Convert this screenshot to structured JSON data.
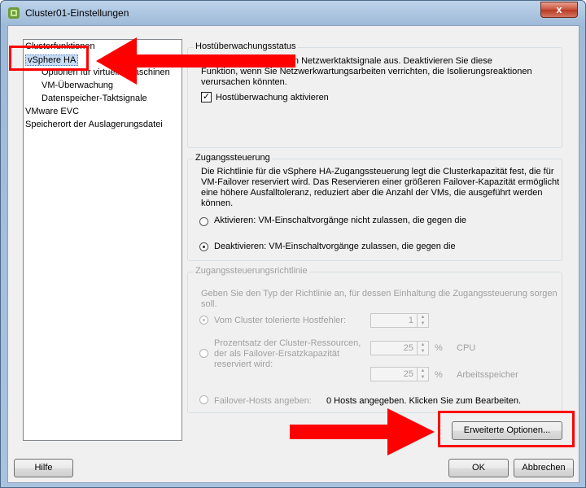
{
  "window": {
    "title": "Cluster01-Einstellungen",
    "close_label": "x"
  },
  "tree": {
    "items": [
      {
        "label": "Clusterfunktionen"
      },
      {
        "label": "vSphere HA"
      },
      {
        "label": "Optionen für virtuelle Maschinen"
      },
      {
        "label": "VM-Überwachung"
      },
      {
        "label": "Datenspeicher-Taktsignale"
      },
      {
        "label": "VMware EVC"
      },
      {
        "label": "Speicherort der Auslagerungsdatei"
      }
    ]
  },
  "host_monitoring": {
    "legend": "Hostüberwachungsstatus",
    "line1": "ster tauschen Netzwerktaktsignale aus. Deaktivieren Sie diese",
    "line2": "Funktion, wenn Sie Netzwerkwartungsarbeiten verrichten, die Isolierungsreaktionen",
    "line3": "verursachen könnten.",
    "checkbox_label": "Hostüberwachung aktivieren",
    "checkbox_checked": true
  },
  "admission": {
    "legend": "Zugangssteuerung",
    "lines": [
      "Die Richtlinie für die vSphere HA-Zugangssteuerung legt die Clusterkapazität fest, die für",
      "VM-Failover reserviert wird. Das Reservieren einer größeren Failover-Kapazität ermöglicht",
      "eine höhere Ausfalltoleranz, reduziert aber die Anzahl der VMs, die ausgeführt werden",
      "können."
    ],
    "option_enable": "Aktivieren: VM-Einschaltvorgänge nicht zulassen, die gegen die",
    "option_disable": "Deaktivieren: VM-Einschaltvorgänge zulassen, die gegen die"
  },
  "policy": {
    "legend": "Zugangssteuerungsrichtlinie",
    "intro1": "Geben Sie den Typ der Richtlinie an, für dessen Einhaltung die Zugangssteuerung sorgen",
    "intro2": "soll.",
    "host_failures_label": "Vom Cluster tolerierte Hostfehler:",
    "host_failures_value": "1",
    "percent_label1": "Prozentsatz der Cluster-Ressourcen,",
    "percent_label2": "der als Failover-Ersatzkapazität",
    "percent_label3": "reserviert wird:",
    "cpu_value": "25",
    "cpu_unit": "%",
    "cpu_label": "CPU",
    "mem_value": "25",
    "mem_unit": "%",
    "mem_label": "Arbeitsspeicher",
    "failover_hosts_label": "Failover-Hosts angeben:",
    "failover_hosts_value": "0 Hosts angegeben. Klicken Sie zum Bearbeiten."
  },
  "buttons": {
    "advanced": "Erweiterte Optionen...",
    "help": "Hilfe",
    "ok": "OK",
    "cancel": "Abbrechen"
  },
  "colors": {
    "annotation": "#ff0000",
    "selection": "#c7dcf5"
  }
}
